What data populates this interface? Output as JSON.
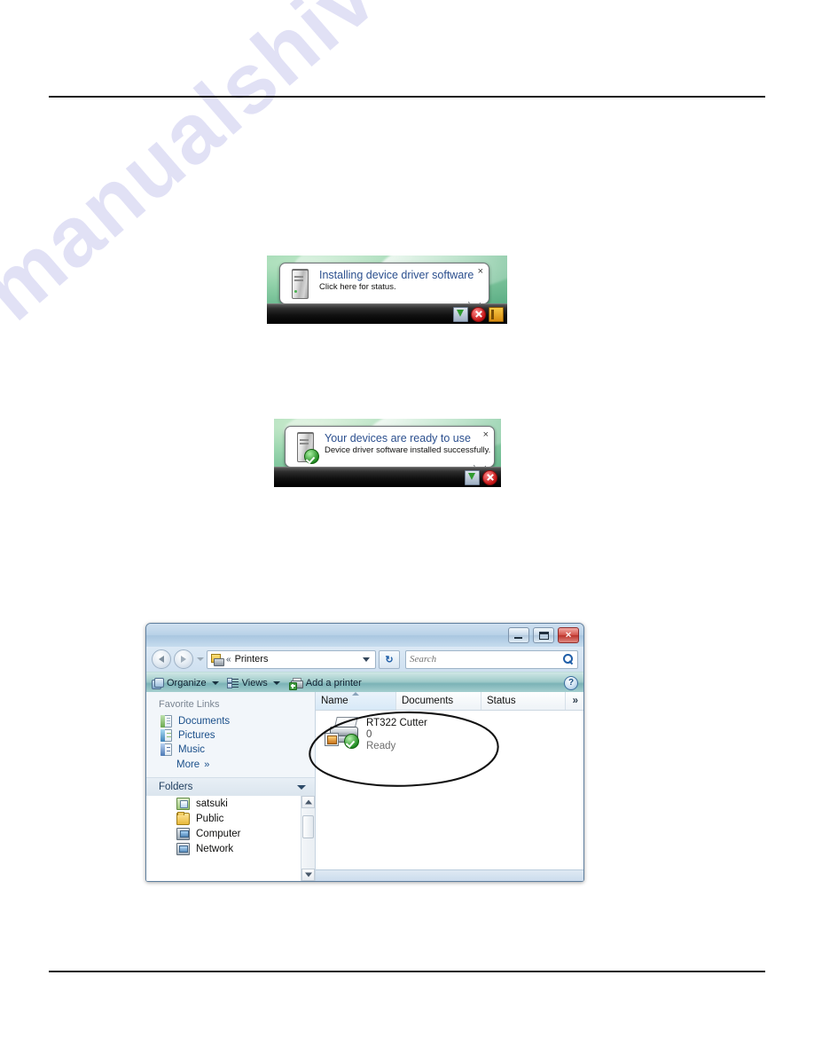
{
  "watermark": {
    "text": "manualshive.com"
  },
  "figure1": {
    "name": "installing-driver-balloon",
    "title": "Installing device driver software",
    "subtitle": "Click here for status.",
    "close_label": "×",
    "icons": {
      "device": "computer-tower-icon",
      "tray_install": "install-progress-tray-icon",
      "tray_security": "security-alert-tray-icon",
      "tray_flag": "action-center-flag-tray-icon"
    }
  },
  "figure2": {
    "name": "devices-ready-balloon",
    "title": "Your devices are ready to use",
    "subtitle": "Device driver software installed successfully.",
    "close_label": "×",
    "icons": {
      "device": "computer-tower-with-check-icon",
      "tray_install": "install-progress-tray-icon",
      "tray_security": "security-alert-tray-icon"
    }
  },
  "explorer": {
    "window_controls": {
      "minimize": "─",
      "maximize": "❐",
      "close": "✕"
    },
    "address": {
      "separator": "«",
      "path": "Printers",
      "refresh_label": "↻"
    },
    "search": {
      "placeholder": "Search",
      "value": ""
    },
    "toolbar": {
      "organize": "Organize",
      "views": "Views",
      "add_printer": "Add a printer",
      "help": "?"
    },
    "nav_pane": {
      "favorites_header": "Favorite Links",
      "favorites": [
        {
          "label": "Documents",
          "icon": "documents-icon"
        },
        {
          "label": "Pictures",
          "icon": "pictures-icon"
        },
        {
          "label": "Music",
          "icon": "music-icon"
        }
      ],
      "more_label": "More",
      "more_chevron": "»",
      "folders_header": "Folders",
      "tree": [
        {
          "label": "satsuki",
          "icon": "user-folder-icon"
        },
        {
          "label": "Public",
          "icon": "folder-icon"
        },
        {
          "label": "Computer",
          "icon": "computer-icon"
        },
        {
          "label": "Network",
          "icon": "network-icon"
        }
      ]
    },
    "list": {
      "columns": [
        "Name",
        "Documents",
        "Status",
        "»"
      ],
      "rows": [
        {
          "name": "RT322 Cutter",
          "documents": "0",
          "status": "Ready",
          "icon": "shared-printer-default-icon"
        }
      ]
    }
  }
}
